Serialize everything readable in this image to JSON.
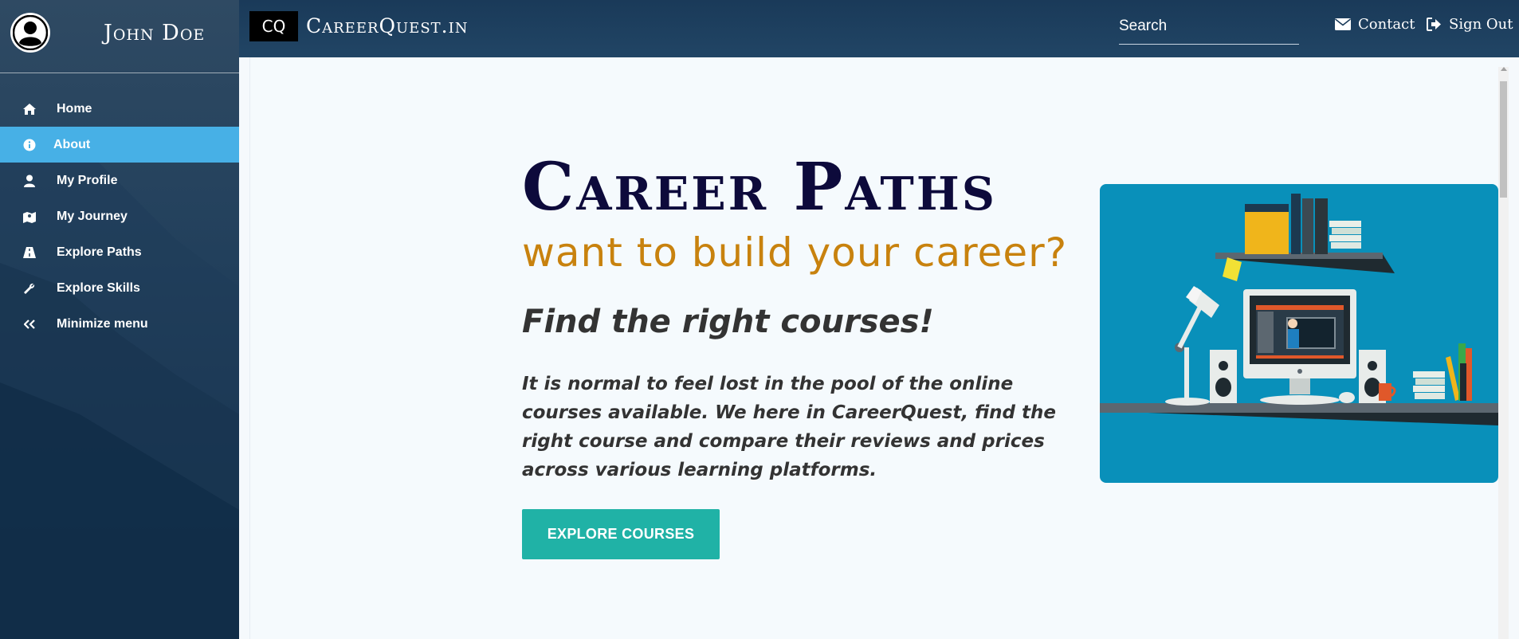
{
  "sidebar": {
    "user_name": "John Doe",
    "items": [
      {
        "label": "Home",
        "icon": "home-icon",
        "active": false
      },
      {
        "label": "About",
        "icon": "info-icon",
        "active": true
      },
      {
        "label": "My Profile",
        "icon": "user-icon",
        "active": false
      },
      {
        "label": "My Journey",
        "icon": "map-icon",
        "active": false
      },
      {
        "label": "Explore Paths",
        "icon": "road-icon",
        "active": false
      },
      {
        "label": "Explore Skills",
        "icon": "wrench-icon",
        "active": false
      },
      {
        "label": "Minimize menu",
        "icon": "double-chevron-left-icon",
        "active": false
      }
    ]
  },
  "topbar": {
    "brand_abbr": "CQ",
    "brand_name": "CareerQuest.in",
    "search_placeholder": "Search",
    "contact_label": "Contact",
    "signout_label": "Sign Out"
  },
  "hero": {
    "title": "Career Paths",
    "tagline": "want to build your career?",
    "subtitle": "Find the right courses!",
    "body": "It is normal to feel lost in the pool of the online courses available. We here in CareerQuest, find the right course and compare their reviews and prices across various learning platforms.",
    "cta_label": "EXPLORE COURSES"
  },
  "colors": {
    "sidebar_active": "#47b0e6",
    "topbar": "#1a3a59",
    "title": "#0d0a3b",
    "tagline": "#c8820e",
    "cta": "#20b2a6",
    "illustration_bg": "#0990ba"
  }
}
